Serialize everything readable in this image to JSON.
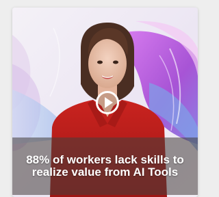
{
  "video": {
    "caption": "88% of workers lack skills to realize value from AI Tools",
    "play_icon": "play-icon",
    "play_state": "paused"
  },
  "colors": {
    "shirt": "#c0201e",
    "background_blue": "#8fb6e8",
    "background_purple": "#b34ad2",
    "caption_band": "#463e3a",
    "caption_text": "#ffffff"
  }
}
